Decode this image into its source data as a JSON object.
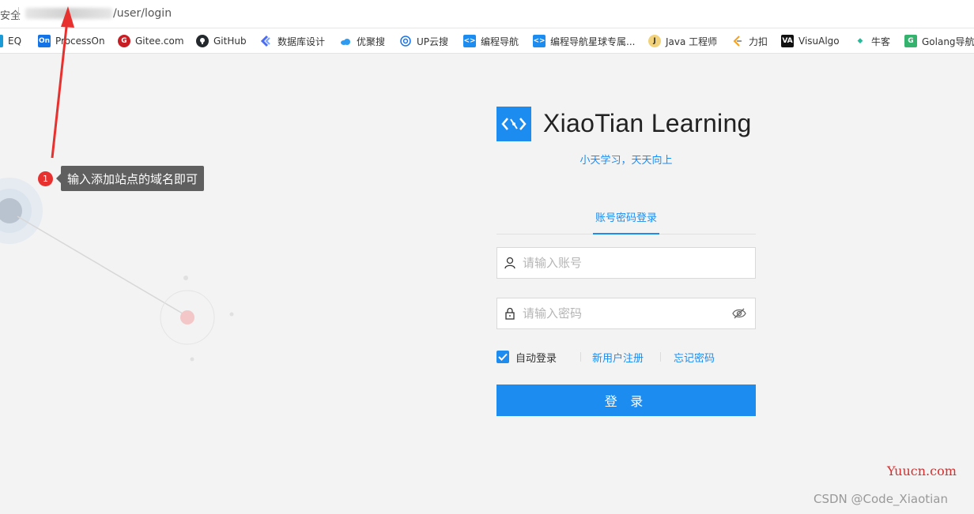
{
  "browser": {
    "security_label": "安全",
    "url_path": "/user/login"
  },
  "bookmarks": [
    {
      "label": "EQ",
      "icon": "eq-icon",
      "color": "#1a9ad6"
    },
    {
      "label": "ProcessOn",
      "icon": "processon-icon",
      "color": "#1473e6"
    },
    {
      "label": "Gitee.com",
      "icon": "gitee-icon",
      "color": "#c71d23"
    },
    {
      "label": "GitHub",
      "icon": "github-icon",
      "color": "#24292e"
    },
    {
      "label": "数据库设计",
      "icon": "database-design-icon",
      "color": "#4b6cf5"
    },
    {
      "label": "优聚搜",
      "icon": "cloud-icon",
      "color": "#2f9bf0"
    },
    {
      "label": "UP云搜",
      "icon": "search-icon",
      "color": "#1a73e8"
    },
    {
      "label": "编程导航",
      "icon": "code-nav-icon",
      "color": "#1d8cf0"
    },
    {
      "label": "编程导航星球专属...",
      "icon": "code-nav-icon",
      "color": "#1d8cf0"
    },
    {
      "label": "Java 工程师",
      "icon": "java-icon",
      "color": "#b07219"
    },
    {
      "label": "力扣",
      "icon": "leetcode-icon",
      "color": "#f89f1b"
    },
    {
      "label": "VisuAlgo",
      "icon": "visualgo-icon",
      "color": "#111111"
    },
    {
      "label": "牛客",
      "icon": "nowcoder-icon",
      "color": "#25bb9b"
    },
    {
      "label": "Golang导航",
      "icon": "golang-icon",
      "color": "#35b26e"
    }
  ],
  "annotation": {
    "badge": "1",
    "text": "输入添加站点的域名即可"
  },
  "login": {
    "brand": "XiaoTian Learning",
    "slogan": "小天学习，天天向上",
    "tab_label": "账号密码登录",
    "username_placeholder": "请输入账号",
    "password_placeholder": "请输入密码",
    "remember_label": "自动登录",
    "remember_checked": true,
    "register_link": "新用户注册",
    "forgot_link": "忘记密码",
    "submit_label": "登 录"
  },
  "watermarks": {
    "site": "Yuucn.com",
    "author": "CSDN @Code_Xiaotian"
  },
  "colors": {
    "accent": "#1d8cf0",
    "annotation_red": "#e8312f"
  }
}
